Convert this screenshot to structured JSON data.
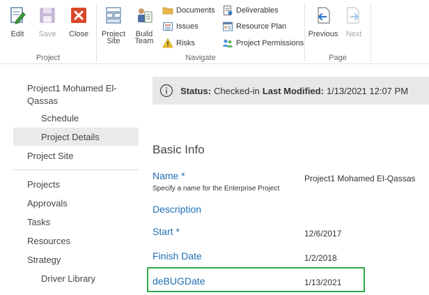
{
  "ribbon": {
    "project_group": {
      "label": "Project",
      "edit": "Edit",
      "save": "Save",
      "close": "Close"
    },
    "navigate_group": {
      "label": "Navigate",
      "project_site": "Project Site",
      "build_team": "Build Team",
      "documents": "Documents",
      "issues": "Issues",
      "risks": "Risks",
      "deliverables": "Deliverables",
      "resource_plan": "Resource Plan",
      "project_permissions": "Project Permissions"
    },
    "page_group": {
      "label": "Page",
      "previous": "Previous",
      "next": "Next"
    }
  },
  "nav": {
    "project_title_line1": "Project1 Mohamed El-",
    "project_title_line2": "Qassas",
    "schedule": "Schedule",
    "project_details": "Project Details",
    "project_site": "Project Site",
    "projects": "Projects",
    "approvals": "Approvals",
    "tasks": "Tasks",
    "resources": "Resources",
    "strategy": "Strategy",
    "driver_library": "Driver Library"
  },
  "status": {
    "status_label": "Status:",
    "status_value": "Checked-in",
    "modified_label": "Last Modified:",
    "modified_value": "1/13/2021 12:07 PM"
  },
  "form": {
    "section_title": "Basic Info",
    "name_label": "Name",
    "name_required": "*",
    "name_desc": "Specify a name for the Enterprise Project",
    "name_value": "Project1 Mohamed El-Qassas",
    "description_label": "Description",
    "start_label": "Start",
    "start_required": "*",
    "start_value": "12/6/2017",
    "finish_label": "Finish Date",
    "finish_value": "1/2/2018",
    "debug_label": "deBUGDate",
    "debug_value": "1/13/2021"
  },
  "colors": {
    "link_blue": "#1f6fb2",
    "highlight_green": "#2fa84f",
    "close_red": "#d9472b"
  }
}
